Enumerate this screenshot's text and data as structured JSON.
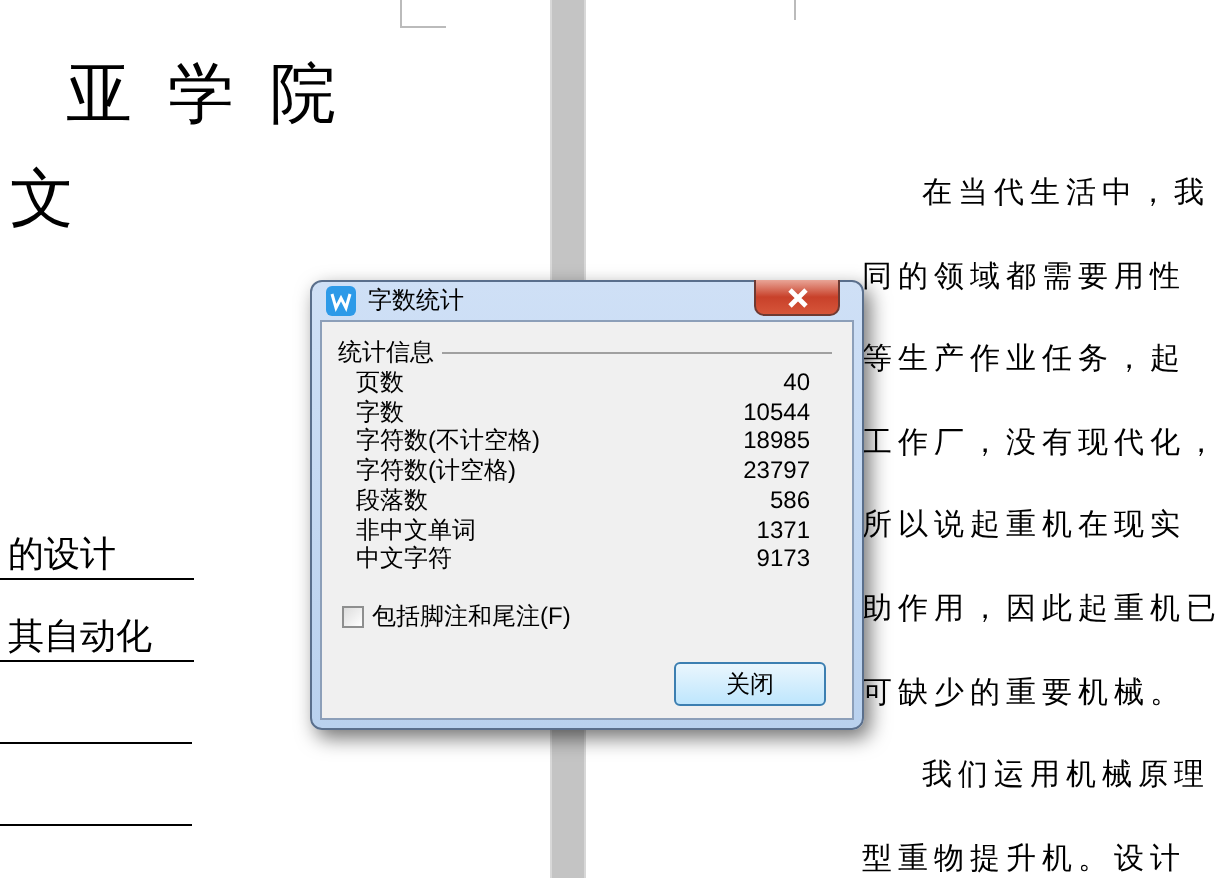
{
  "left_page": {
    "title": "亚学院",
    "subtitle": "文",
    "fields": [
      {
        "kind": "filled",
        "text": "的设计"
      },
      {
        "kind": "filled",
        "text": "其自动化"
      },
      {
        "kind": "blank"
      },
      {
        "kind": "blank"
      }
    ]
  },
  "right_page": {
    "paragraphs": [
      {
        "lines": [
          "在当代生活中，我",
          "同的领域都需要用性",
          "等生产作业任务，起",
          "工作厂，没有现代化，",
          "所以说起重机在现实",
          "助作用，因此起重机已",
          "可缺少的重要机械。"
        ]
      },
      {
        "lines": [
          "我们运用机械原理",
          "型重物提升机。设计"
        ]
      }
    ]
  },
  "dialog": {
    "title": "字数统计",
    "group_title": "统计信息",
    "stats": [
      {
        "label": "页数",
        "value": "40"
      },
      {
        "label": "字数",
        "value": "10544"
      },
      {
        "label": "字符数(不计空格)",
        "value": "18985"
      },
      {
        "label": "字符数(计空格)",
        "value": "23797"
      },
      {
        "label": "段落数",
        "value": "586"
      },
      {
        "label": "非中文单词",
        "value": "1371"
      },
      {
        "label": "中文字符",
        "value": "9173"
      }
    ],
    "checkbox": {
      "label": "包括脚注和尾注(F)",
      "checked": false
    },
    "button": "关闭"
  }
}
